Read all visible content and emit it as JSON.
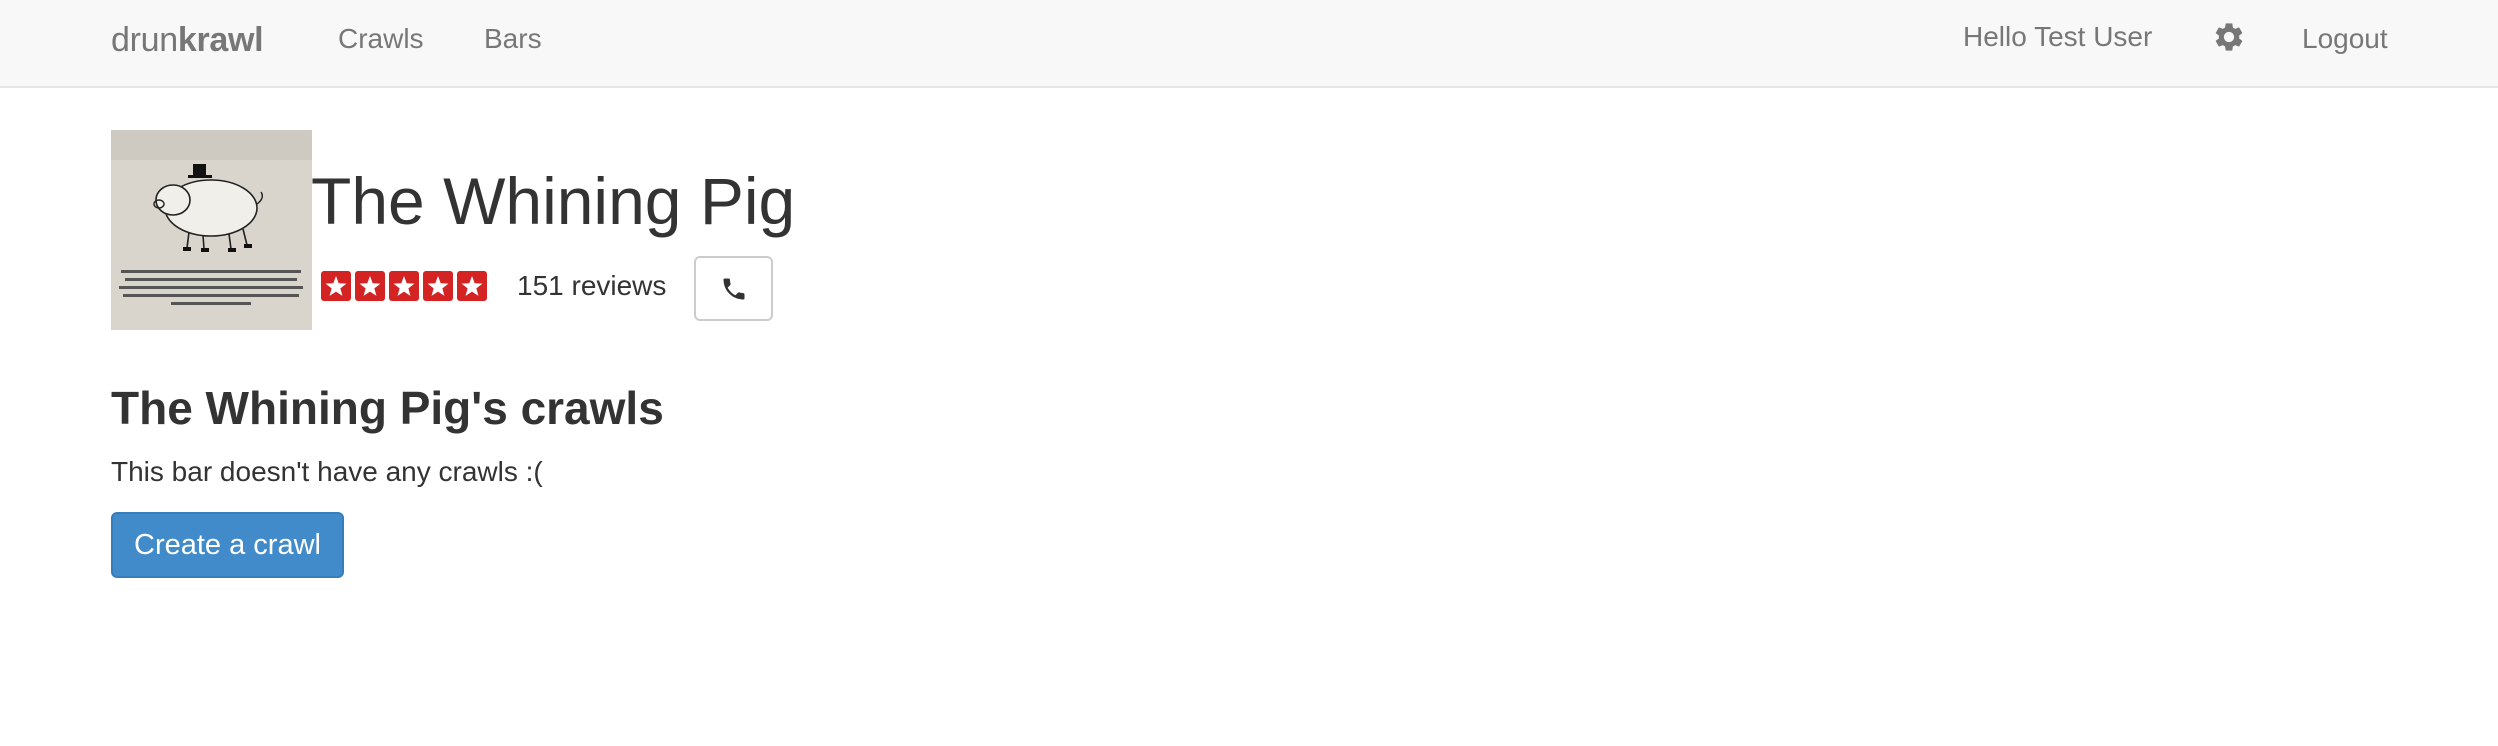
{
  "navbar": {
    "brand_light": "drun",
    "brand_bold": "krawl",
    "links": [
      "Crawls",
      "Bars"
    ],
    "greeting": "Hello Test User",
    "settings_icon": "gear-icon",
    "logout": "Logout"
  },
  "bar": {
    "photo_icon": "pig-illustration",
    "name": "The Whining Pig",
    "rating": 5,
    "rating_max": 5,
    "reviews": "151 reviews",
    "phone_icon": "phone-icon"
  },
  "crawls": {
    "title": "The Whining Pig's crawls",
    "empty_message": "This bar doesn't have any crawls :(",
    "create_label": "Create a crawl"
  },
  "colors": {
    "navbar_bg": "#f8f8f8",
    "primary": "#428bca",
    "star_red": "#d32323"
  }
}
